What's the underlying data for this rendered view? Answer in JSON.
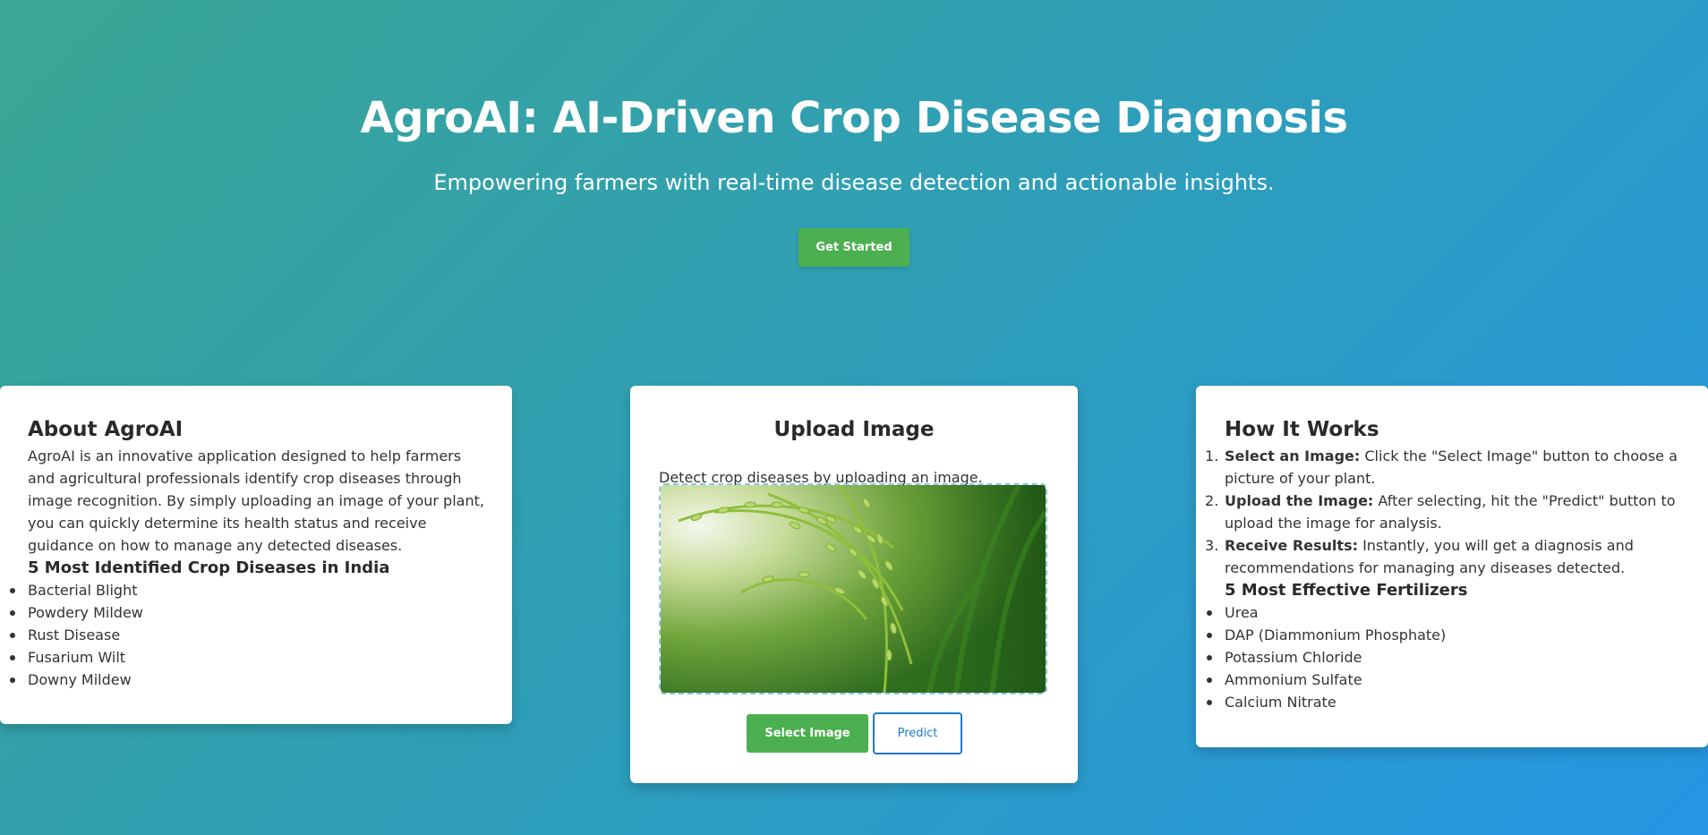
{
  "hero": {
    "title": "AgroAI: AI-Driven Crop Disease Diagnosis",
    "tagline": "Empowering farmers with real-time disease detection and actionable insights.",
    "cta_label": "Get Started"
  },
  "about": {
    "title": "About AgroAI",
    "description": "AgroAI is an innovative application designed to help farmers and agricultural professionals identify crop diseases through image recognition. By simply uploading an image of your plant, you can quickly determine its health status and receive guidance on how to manage any detected diseases.",
    "diseases_title": "5 Most Identified Crop Diseases in India",
    "diseases": [
      "Bacterial Blight",
      "Powdery Mildew",
      "Rust Disease",
      "Fusarium Wilt",
      "Downy Mildew"
    ]
  },
  "upload": {
    "title": "Upload Image",
    "description": "Detect crop diseases by uploading an image.",
    "select_label": "Select Image",
    "predict_label": "Predict"
  },
  "how": {
    "title": "How It Works",
    "steps": [
      {
        "bold": "Select an Image:",
        "text": " Click the \"Select Image\" button to choose a picture of your plant."
      },
      {
        "bold": "Upload the Image:",
        "text": " After selecting, hit the \"Predict\" button to upload the image for analysis."
      },
      {
        "bold": "Receive Results:",
        "text": " Instantly, you will get a diagnosis and recommendations for managing any diseases detected."
      }
    ],
    "fertilizers_title": "5 Most Effective Fertilizers",
    "fertilizers": [
      "Urea",
      "DAP (Diammonium Phosphate)",
      "Potassium Chloride",
      "Ammonium Sulfate",
      "Calcium Nitrate"
    ]
  },
  "colors": {
    "accent_green": "#4caf50",
    "accent_blue": "#1e78d2"
  }
}
